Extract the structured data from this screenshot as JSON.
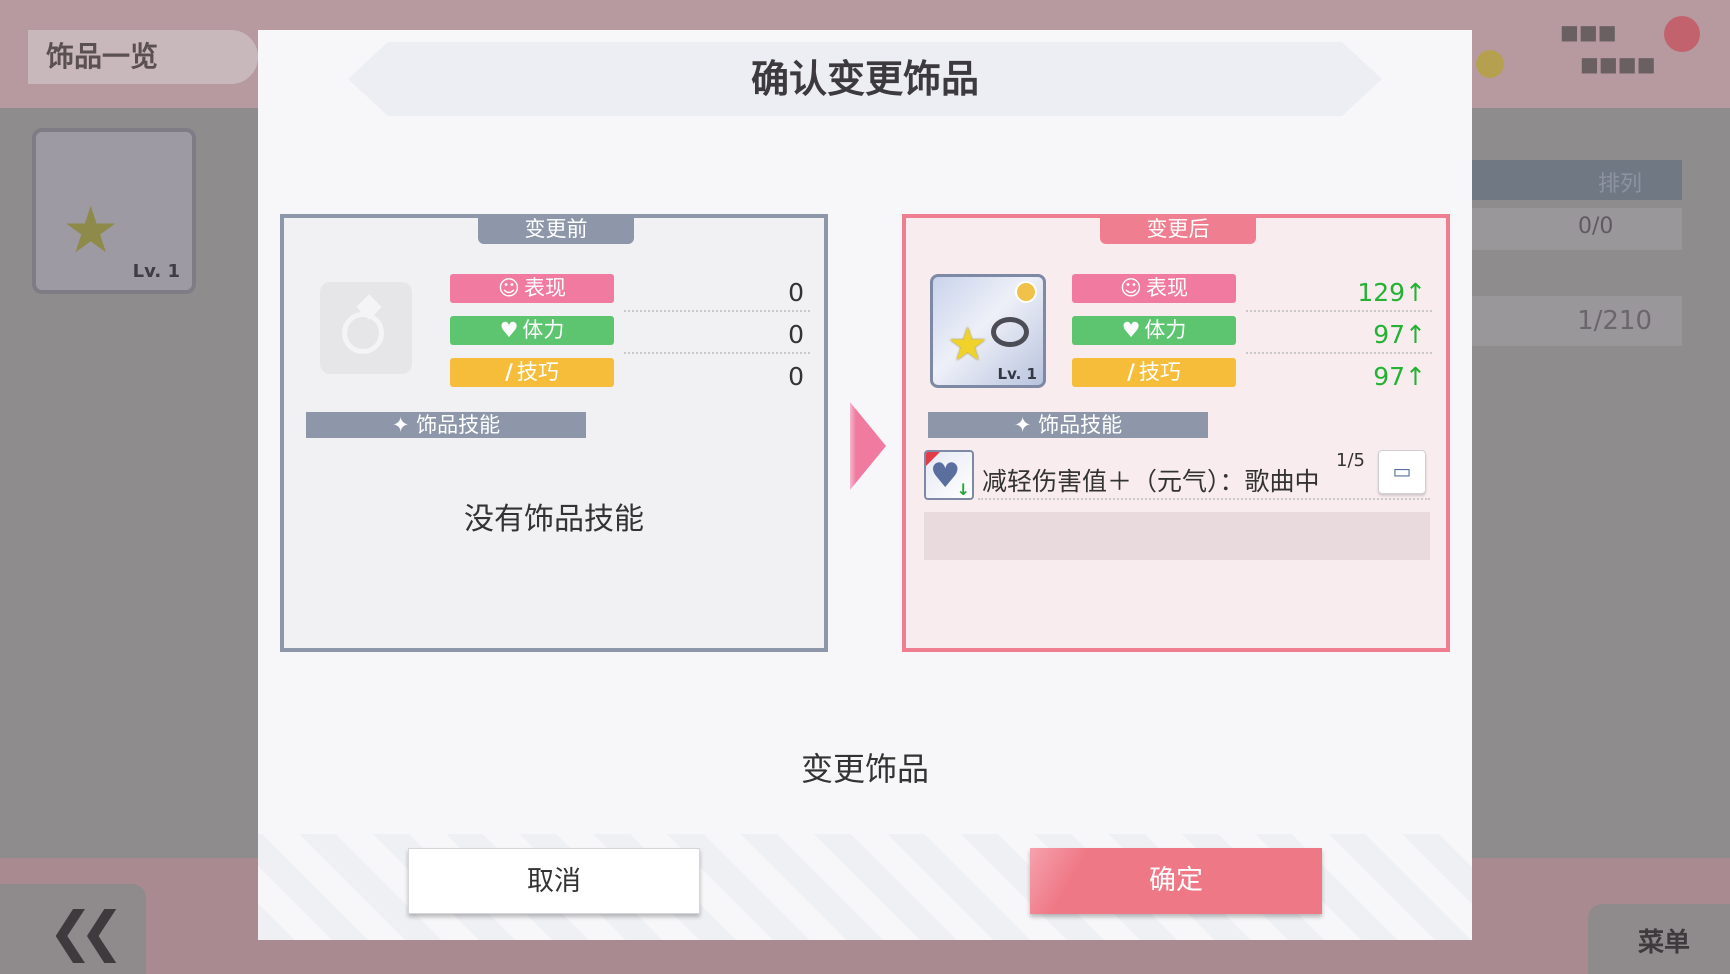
{
  "background": {
    "title": "饰品一览",
    "thumb_level": "Lv. 1",
    "back_label": "《",
    "menu_label": "菜单",
    "column_header": "排列",
    "row_value": "0/0",
    "count": "1/210"
  },
  "dialog": {
    "title": "确认变更饰品",
    "before": {
      "tab": "变更前",
      "stats": [
        {
          "icon": "smile-icon",
          "glyph": "☺",
          "label": "表现",
          "value": "0"
        },
        {
          "icon": "heart-icon",
          "glyph": "♥",
          "label": "体力",
          "value": "0"
        },
        {
          "icon": "wand-icon",
          "glyph": "/",
          "label": "技巧",
          "value": "0"
        }
      ],
      "skill_header": "饰品技能",
      "no_skill_text": "没有饰品技能"
    },
    "after": {
      "tab": "变更后",
      "card_level": "Lv. 1",
      "stats": [
        {
          "icon": "smile-icon",
          "glyph": "☺",
          "label": "表现",
          "value": "129↑"
        },
        {
          "icon": "heart-icon",
          "glyph": "♥",
          "label": "体力",
          "value": "97↑"
        },
        {
          "icon": "wand-icon",
          "glyph": "/",
          "label": "技巧",
          "value": "97↑"
        }
      ],
      "skill_header": "饰品技能",
      "skill_name": "减轻伤害值＋（元气）：歌曲中",
      "skill_level": "1/5"
    },
    "subtitle": "变更饰品",
    "cancel_label": "取消",
    "confirm_label": "确定"
  },
  "colors": {
    "accent_pink": "#ef7886",
    "before_border": "#8d97a9",
    "after_border": "#ef7f90",
    "stat_performance": "#f07aa0",
    "stat_stamina": "#5dc570",
    "stat_technique": "#f5bd3a",
    "increase_green": "#24b234"
  }
}
